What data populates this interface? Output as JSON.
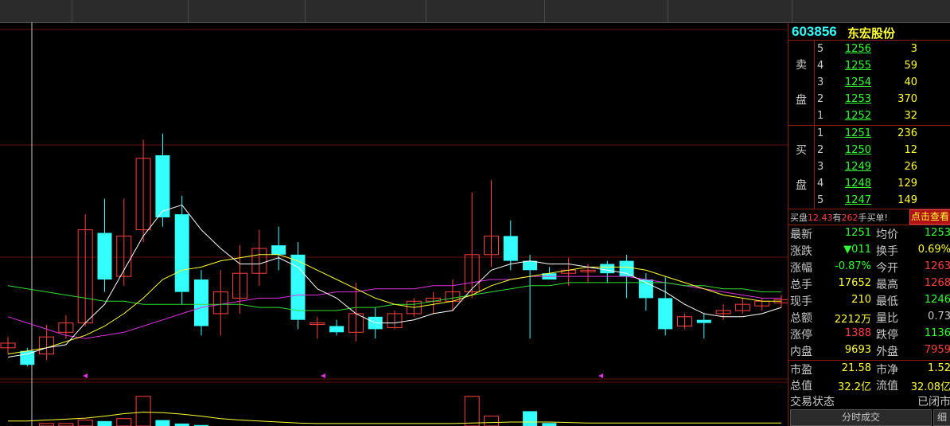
{
  "stock": {
    "code": "603856",
    "name": "东宏股份"
  },
  "colors": {
    "up": "#ff4040",
    "down": "#33ffff",
    "flat": "#33ff33",
    "neutral": "#c8c8c8",
    "vol": "#ffff33"
  },
  "sell": {
    "label_top": "卖",
    "label_bottom": "盘",
    "rows": [
      {
        "level": "5",
        "price": "1256",
        "vol": "3"
      },
      {
        "level": "4",
        "price": "1255",
        "vol": "59"
      },
      {
        "level": "3",
        "price": "1254",
        "vol": "40"
      },
      {
        "level": "2",
        "price": "1253",
        "vol": "370"
      },
      {
        "level": "1",
        "price": "1252",
        "vol": "32"
      }
    ]
  },
  "buy": {
    "label_top": "买",
    "label_bottom": "盘",
    "rows": [
      {
        "level": "1",
        "price": "1251",
        "vol": "236"
      },
      {
        "level": "2",
        "price": "1250",
        "vol": "12"
      },
      {
        "level": "3",
        "price": "1249",
        "vol": "26"
      },
      {
        "level": "4",
        "price": "1248",
        "vol": "129"
      },
      {
        "level": "5",
        "price": "1247",
        "vol": "149"
      }
    ]
  },
  "note": {
    "pre": "买盘",
    "price": "12.43",
    "mid": "有",
    "vol": "262",
    "post": "手买单!",
    "button": "点击查看"
  },
  "quote": [
    {
      "l1": "最新",
      "v1": "1251",
      "c1": "#33ff33",
      "l2": "均价",
      "v2": "1253",
      "c2": "#33ff33"
    },
    {
      "l1": "涨跌",
      "v1": "▼011",
      "c1": "#33ff33",
      "l2": "换手",
      "v2": "0.69%",
      "c2": "#ffff33"
    },
    {
      "l1": "涨幅",
      "v1": "-0.87%",
      "c1": "#33ff33",
      "l2": "今开",
      "v2": "1263",
      "c2": "#ff4040"
    },
    {
      "l1": "总手",
      "v1": "17652",
      "c1": "#ffff33",
      "l2": "最高",
      "v2": "1268",
      "c2": "#ff4040"
    },
    {
      "l1": "现手",
      "v1": "210",
      "c1": "#ffff33",
      "l2": "最低",
      "v2": "1246",
      "c2": "#33ff33"
    },
    {
      "l1": "总额",
      "v1": "2212万",
      "c1": "#ffff33",
      "l2": "量比",
      "v2": "0.73",
      "c2": "#c8c8c8"
    },
    {
      "l1": "涨停",
      "v1": "1388",
      "c1": "#ff4040",
      "l2": "跌停",
      "v2": "1136",
      "c2": "#33ff33"
    },
    {
      "l1": "内盘",
      "v1": "9693",
      "c1": "#ffff33",
      "l2": "外盘",
      "v2": "7959",
      "c2": "#ff4040"
    }
  ],
  "fundamentals": [
    {
      "l1": "市盈",
      "v1": "21.58",
      "l2": "市净",
      "v2": "1.52"
    },
    {
      "l1": "总值",
      "v1": "32.2亿",
      "l2": "流值",
      "v2": "32.08亿"
    }
  ],
  "status": {
    "label": "交易状态",
    "value": "已闭市"
  },
  "buttons": {
    "ticks": "分时成交",
    "detail": "细"
  },
  "chart_data": {
    "type": "candlestick",
    "candles": [
      {
        "o": 0.08,
        "c": 0.095,
        "h": 0.115,
        "l": 0.06
      },
      {
        "o": 0.07,
        "c": 0.025,
        "h": 0.08,
        "l": 0.02
      },
      {
        "o": 0.06,
        "c": 0.115,
        "h": 0.155,
        "l": 0.04
      },
      {
        "o": 0.13,
        "c": 0.16,
        "h": 0.185,
        "l": 0.11
      },
      {
        "o": 0.16,
        "c": 0.46,
        "h": 0.51,
        "l": 0.15
      },
      {
        "o": 0.45,
        "c": 0.3,
        "h": 0.56,
        "l": 0.26
      },
      {
        "o": 0.31,
        "c": 0.44,
        "h": 0.56,
        "l": 0.28
      },
      {
        "o": 0.46,
        "c": 0.69,
        "h": 0.75,
        "l": 0.42
      },
      {
        "o": 0.7,
        "c": 0.5,
        "h": 0.77,
        "l": 0.47
      },
      {
        "o": 0.51,
        "c": 0.26,
        "h": 0.57,
        "l": 0.22
      },
      {
        "o": 0.3,
        "c": 0.15,
        "h": 0.33,
        "l": 0.12
      },
      {
        "o": 0.19,
        "c": 0.26,
        "h": 0.33,
        "l": 0.12
      },
      {
        "o": 0.24,
        "c": 0.32,
        "h": 0.41,
        "l": 0.19
      },
      {
        "o": 0.32,
        "c": 0.4,
        "h": 0.46,
        "l": 0.28
      },
      {
        "o": 0.41,
        "c": 0.38,
        "h": 0.47,
        "l": 0.33
      },
      {
        "o": 0.38,
        "c": 0.17,
        "h": 0.42,
        "l": 0.14
      },
      {
        "o": 0.16,
        "c": 0.16,
        "h": 0.18,
        "l": 0.11
      },
      {
        "o": 0.15,
        "c": 0.13,
        "h": 0.17,
        "l": 0.12
      },
      {
        "o": 0.13,
        "c": 0.19,
        "h": 0.29,
        "l": 0.1
      },
      {
        "o": 0.18,
        "c": 0.14,
        "h": 0.21,
        "l": 0.11
      },
      {
        "o": 0.145,
        "c": 0.19,
        "h": 0.2,
        "l": 0.14
      },
      {
        "o": 0.19,
        "c": 0.23,
        "h": 0.24,
        "l": 0.18
      },
      {
        "o": 0.23,
        "c": 0.24,
        "h": 0.26,
        "l": 0.19
      },
      {
        "o": 0.23,
        "c": 0.26,
        "h": 0.3,
        "l": 0.2
      },
      {
        "o": 0.26,
        "c": 0.38,
        "h": 0.58,
        "l": 0.24
      },
      {
        "o": 0.38,
        "c": 0.44,
        "h": 0.62,
        "l": 0.34
      },
      {
        "o": 0.44,
        "c": 0.36,
        "h": 0.49,
        "l": 0.33
      },
      {
        "o": 0.36,
        "c": 0.33,
        "h": 0.38,
        "l": 0.11
      },
      {
        "o": 0.32,
        "c": 0.3,
        "h": 0.34,
        "l": 0.3
      },
      {
        "o": 0.32,
        "c": 0.33,
        "h": 0.37,
        "l": 0.28
      },
      {
        "o": 0.33,
        "c": 0.33,
        "h": 0.35,
        "l": 0.29
      },
      {
        "o": 0.35,
        "c": 0.32,
        "h": 0.36,
        "l": 0.29
      },
      {
        "o": 0.36,
        "c": 0.31,
        "h": 0.38,
        "l": 0.24
      },
      {
        "o": 0.3,
        "c": 0.24,
        "h": 0.32,
        "l": 0.2
      },
      {
        "o": 0.24,
        "c": 0.14,
        "h": 0.31,
        "l": 0.12
      },
      {
        "o": 0.15,
        "c": 0.18,
        "h": 0.19,
        "l": 0.14
      },
      {
        "o": 0.17,
        "c": 0.16,
        "h": 0.19,
        "l": 0.11
      },
      {
        "o": 0.19,
        "c": 0.2,
        "h": 0.22,
        "l": 0.17
      },
      {
        "o": 0.2,
        "c": 0.22,
        "h": 0.24,
        "l": 0.19
      },
      {
        "o": 0.215,
        "c": 0.23,
        "h": 0.24,
        "l": 0.2
      },
      {
        "o": 0.225,
        "c": 0.235,
        "h": 0.25,
        "l": 0.21
      }
    ],
    "ma5": [
      0.05,
      0.06,
      0.08,
      0.09,
      0.16,
      0.22,
      0.33,
      0.44,
      0.52,
      0.54,
      0.46,
      0.4,
      0.35,
      0.35,
      0.37,
      0.34,
      0.27,
      0.24,
      0.19,
      0.16,
      0.16,
      0.17,
      0.19,
      0.2,
      0.27,
      0.33,
      0.35,
      0.36,
      0.35,
      0.35,
      0.34,
      0.33,
      0.32,
      0.29,
      0.26,
      0.22,
      0.19,
      0.18,
      0.18,
      0.19,
      0.21
    ],
    "ma10": [
      0.06,
      0.07,
      0.08,
      0.1,
      0.12,
      0.15,
      0.19,
      0.24,
      0.3,
      0.33,
      0.34,
      0.36,
      0.37,
      0.38,
      0.38,
      0.36,
      0.33,
      0.3,
      0.27,
      0.24,
      0.22,
      0.21,
      0.22,
      0.23,
      0.25,
      0.28,
      0.3,
      0.31,
      0.32,
      0.33,
      0.34,
      0.34,
      0.34,
      0.33,
      0.31,
      0.29,
      0.27,
      0.25,
      0.24,
      0.23,
      0.23
    ],
    "ma20": [
      0.28,
      0.27,
      0.26,
      0.25,
      0.24,
      0.23,
      0.23,
      0.22,
      0.22,
      0.22,
      0.22,
      0.22,
      0.22,
      0.21,
      0.21,
      0.2,
      0.2,
      0.2,
      0.21,
      0.21,
      0.22,
      0.22,
      0.23,
      0.24,
      0.25,
      0.26,
      0.27,
      0.28,
      0.28,
      0.29,
      0.29,
      0.29,
      0.29,
      0.29,
      0.29,
      0.28,
      0.28,
      0.27,
      0.27,
      0.26,
      0.26
    ],
    "ma60": [
      0.18,
      0.16,
      0.14,
      0.12,
      0.11,
      0.12,
      0.13,
      0.15,
      0.17,
      0.19,
      0.21,
      0.22,
      0.23,
      0.24,
      0.24,
      0.25,
      0.25,
      0.26,
      0.26,
      0.27,
      0.27,
      0.27,
      0.28,
      0.28,
      0.29,
      0.3,
      0.3,
      0.31,
      0.31,
      0.31,
      0.31,
      0.31,
      0.31,
      0.3,
      0.29,
      0.28,
      0.27,
      0.26,
      0.25,
      0.24,
      0.24
    ],
    "ma_colors": {
      "ma5": "#ffffff",
      "ma10": "#ffff33",
      "ma20": "#33dd33",
      "ma60": "#dd33dd"
    },
    "volume": [
      0,
      0,
      0.05,
      0.05,
      0.12,
      0.1,
      0.15,
      0.6,
      0.12,
      0.05,
      0.02,
      0,
      0,
      0,
      0,
      0,
      0,
      0,
      0,
      0,
      0,
      0,
      0,
      0,
      0.6,
      0.2,
      0,
      0.3,
      0.06,
      0,
      0,
      0,
      0,
      0,
      0,
      0,
      0,
      0,
      0,
      0,
      0
    ],
    "volume_ma": [
      0.1,
      0.1,
      0.12,
      0.14,
      0.16,
      0.2,
      0.25,
      0.28,
      0.27,
      0.24,
      0.2,
      0.15,
      0.12,
      0.1,
      0.08,
      0.06,
      0.05,
      0.05,
      0.05,
      0.05,
      0.05,
      0.05,
      0.05,
      0.05,
      0.06,
      0.07,
      0.08,
      0.08,
      0.08,
      0.07,
      0.06,
      0.06,
      0.06,
      0.06,
      0.06,
      0.06,
      0.06,
      0.06,
      0.06,
      0.06,
      0.06
    ]
  }
}
